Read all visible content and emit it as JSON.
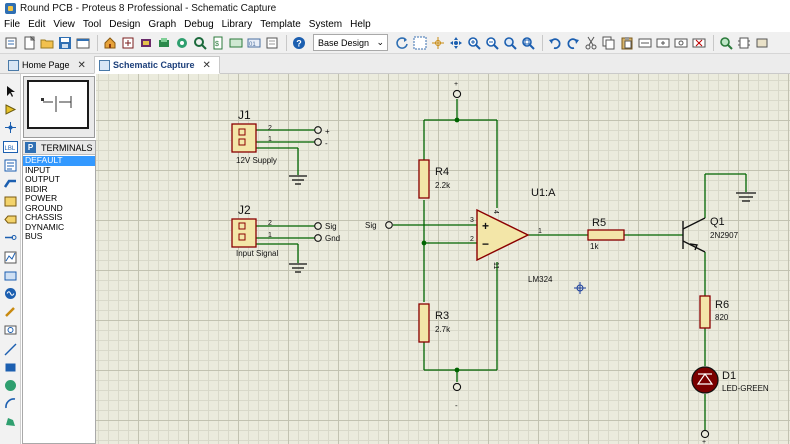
{
  "window": {
    "title": "Round PCB - Proteus 8 Professional - Schematic Capture"
  },
  "menu": [
    "File",
    "Edit",
    "View",
    "Tool",
    "Design",
    "Graph",
    "Debug",
    "Library",
    "Template",
    "System",
    "Help"
  ],
  "toolbar": {
    "design_select": "Base Design"
  },
  "tabs": [
    {
      "label": "Home Page",
      "active": false
    },
    {
      "label": "Schematic Capture",
      "active": true
    }
  ],
  "terminals": {
    "panel_button": "P",
    "header": "TERMINALS",
    "items": [
      "DEFAULT",
      "INPUT",
      "OUTPUT",
      "BIDIR",
      "POWER",
      "GROUND",
      "CHASSIS",
      "DYNAMIC",
      "BUS"
    ],
    "selected": "DEFAULT"
  },
  "schematic": {
    "j1": {
      "ref": "J1",
      "value": "12V Supply",
      "pin2": "2",
      "pin1": "1",
      "net_plus": "+",
      "net_minus": "-"
    },
    "j2": {
      "ref": "J2",
      "value": "Input Signal",
      "pin2": "2",
      "pin1": "1",
      "net_sig": "Sig",
      "net_gnd": "Gnd"
    },
    "r4": {
      "ref": "R4",
      "value": "2.2k"
    },
    "r3": {
      "ref": "R3",
      "value": "2.7k"
    },
    "u1": {
      "ref": "U1:A",
      "value": "LM324",
      "pin_in_plus": "3",
      "pin_in_minus": "2",
      "pin_out": "1",
      "pin_vcc": "4",
      "pin_gnd": "11",
      "sym_plus": "+",
      "sym_minus": "−"
    },
    "r5": {
      "ref": "R5",
      "value": "1k"
    },
    "q1": {
      "ref": "Q1",
      "value": "2N2907"
    },
    "r6": {
      "ref": "R6",
      "value": "820"
    },
    "d1": {
      "ref": "D1",
      "value": "LED-GREEN"
    },
    "sig_label": "Sig",
    "top_power": "+",
    "bottom_ground": "-",
    "right_power": "+"
  },
  "colors": {
    "wire": "#006400",
    "component": "#8b0000",
    "resistor_fill": "#f3e6a8",
    "canvas_bg": "#ebebdd",
    "selection_blue": "#3399ff"
  }
}
